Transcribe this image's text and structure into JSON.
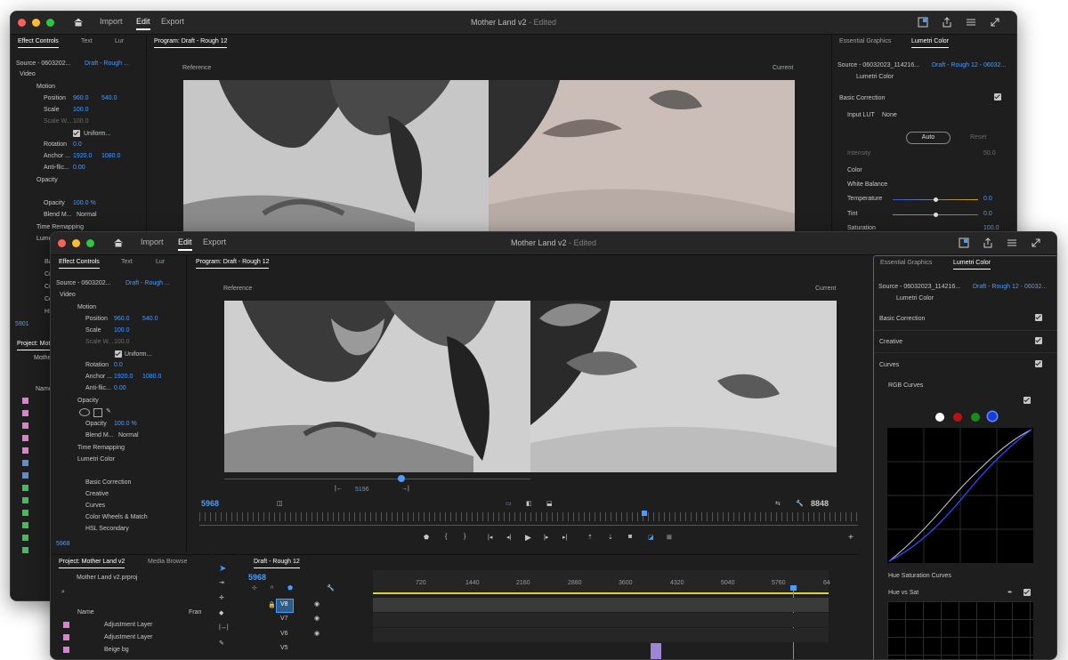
{
  "app": {
    "title": "Mother Land v2",
    "edited": " - Edited",
    "workspaces": [
      "Import",
      "Edit",
      "Export"
    ]
  },
  "back": {
    "effect_tabs": [
      "Effect Controls",
      "Text",
      "Lur"
    ],
    "program_label": "Program: Draft - Rough 12",
    "reference": "Reference",
    "current": "Current",
    "source": "Source - 0603202...",
    "source_seq": "Draft - Rough ...",
    "video": "Video",
    "motion": "Motion",
    "position": "Position",
    "pos_x": "960.0",
    "pos_y": "540.0",
    "scale": "Scale",
    "scale_val": "100.0",
    "scale_w": "Scale W...",
    "scale_w_val": "100.0",
    "uniform": "Uniform...",
    "rotation": "Rotation",
    "rotation_val": "0.0",
    "anchor": "Anchor ...",
    "anchor_x": "1920.0",
    "anchor_y": "1080.0",
    "antiflicker": "Anti-flic...",
    "antiflicker_val": "0.00",
    "opacity": "Opacity",
    "opacity_val": "100.0 %",
    "blend": "Blend M...",
    "blend_val": "Normal",
    "time_remap": "Time Remapping",
    "lumetri_partial": "Lume",
    "timecode": "5901",
    "project_tab": "Project: Mot",
    "mother": "Mothe",
    "name": "Name",
    "side_items": [
      "Ba",
      "Cre",
      "Cu",
      "Co",
      "HS"
    ],
    "ess_tabs": [
      "Essential Graphics",
      "Lumetri Color"
    ],
    "lumetri_source": "Source - 06032023_114216...",
    "lumetri_seq": "Draft - Rough 12 - 06032...",
    "lumetri_fx": "Lumetri Color",
    "basic_correction": "Basic Correction",
    "input_lut": "Input LUT",
    "input_lut_val": "None",
    "auto": "Auto",
    "reset": "Reset",
    "intensity": "Intensity",
    "intensity_val": "50.0",
    "color": "Color",
    "white_balance": "White Balance",
    "temperature": "Temperature",
    "temperature_val": "0.0",
    "tint": "Tint",
    "tint_val": "0.0",
    "saturation": "Saturation",
    "saturation_val": "100.0"
  },
  "front": {
    "effect_tabs": [
      "Effect Controls",
      "Text",
      "Lur"
    ],
    "program_label": "Program: Draft - Rough 12",
    "reference": "Reference",
    "current": "Current",
    "source": "Source - 0603202...",
    "source_seq": "Draft - Rough ...",
    "video": "Video",
    "motion": "Motion",
    "position": "Position",
    "pos_x": "960.0",
    "pos_y": "540.0",
    "scale": "Scale",
    "scale_val": "100.0",
    "scale_w": "Scale W...",
    "scale_w_val": "100.0",
    "uniform": "Uniform...",
    "rotation": "Rotation",
    "rotation_val": "0.0",
    "anchor": "Anchor ...",
    "anchor_x": "1920.0",
    "anchor_y": "1080.0",
    "antiflicker": "Anti-flic...",
    "antiflicker_val": "0.00",
    "opacity": "Opacity",
    "opacity_val": "100.0 %",
    "blend": "Blend M...",
    "blend_val": "Normal",
    "time_remap": "Time Remapping",
    "lumetri": "Lumetri Color",
    "lumetri_items": [
      "Basic Correction",
      "Creative",
      "Curves",
      "Color Wheels & Match",
      "HSL Secondary"
    ],
    "ec_timecode": "5968",
    "ref_timecode": "5196",
    "playhead_timecode": "5968",
    "duration": "8848",
    "project_tabs": [
      "Project: Mother Land v2",
      "Media Browse"
    ],
    "project_file": "Mother Land v2.prproj",
    "name_col": "Name",
    "frame_col": "Fran",
    "project_items": [
      "Adjustment Layer",
      "Adjustment Layer",
      "Beige bg"
    ],
    "project_colors": [
      "#e07fd1",
      "#e07fd1",
      "#e07fd1"
    ],
    "timeline_tab": "Draft - Rough 12",
    "timeline_tc": "5968",
    "ruler": [
      "720",
      "1440",
      "2160",
      "2880",
      "3600",
      "4320",
      "5040",
      "5760",
      "64"
    ],
    "tracks": [
      "V8",
      "V7",
      "V6",
      "V5"
    ],
    "ess_tabs": [
      "Essential Graphics",
      "Lumetri Color"
    ],
    "lumetri_source": "Source - 06032023_114216...",
    "lumetri_seq": "Draft - Rough 12 - 06032...",
    "lumetri_fx": "Lumetri Color",
    "sections": [
      "Basic Correction",
      "Creative",
      "Curves"
    ],
    "rgb_curves": "RGB Curves",
    "hue_sat_curves": "Hue Saturation Curves",
    "hue_vs_sat": "Hue vs Sat"
  },
  "colors": {
    "accent": "#4a9cff",
    "panel": "#1e1e1e",
    "titlebar": "#262626",
    "label_pink": "#e07fd1",
    "label_green": "#3fbf5a",
    "label_blue": "#5a8fd6"
  }
}
